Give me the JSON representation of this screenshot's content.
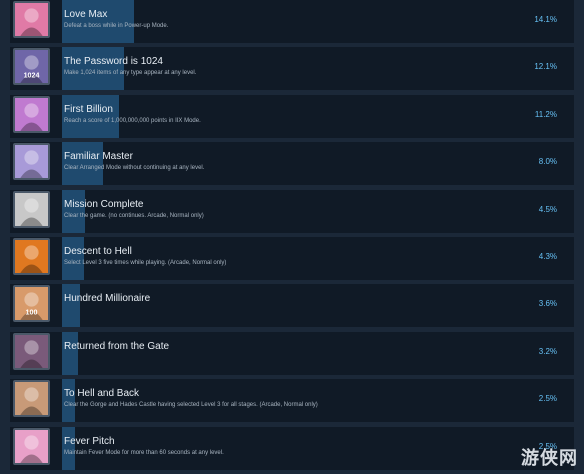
{
  "achievements": [
    {
      "title": "Love Max",
      "description": "Defeat a boss while in Power-up Mode.",
      "percent": "14.1%",
      "bar_fraction": 0.141,
      "icon": "love-max-icon",
      "icon_color": "#e07aa6"
    },
    {
      "title": "The Password is 1024",
      "description": "Make 1,024 items of any type appear at any level.",
      "percent": "12.1%",
      "bar_fraction": 0.121,
      "icon": "password-icon",
      "icon_color": "#6f66a8",
      "icon_text": "1024"
    },
    {
      "title": "First Billion",
      "description": "Reach a score of 1,000,000,000 points in IIX Mode.",
      "percent": "11.2%",
      "bar_fraction": 0.112,
      "icon": "first-billion-icon",
      "icon_color": "#c07ad0"
    },
    {
      "title": "Familiar Master",
      "description": "Clear Arranged Mode without continuing at any level.",
      "percent": "8.0%",
      "bar_fraction": 0.08,
      "icon": "familiar-master-icon",
      "icon_color": "#a89ad8"
    },
    {
      "title": "Mission Complete",
      "description": "Clear the game. (no continues. Arcade, Normal only)",
      "percent": "4.5%",
      "bar_fraction": 0.045,
      "icon": "mission-complete-icon",
      "icon_color": "#c8c8c8"
    },
    {
      "title": "Descent to Hell",
      "description": "Select Level 3 five times while playing. (Arcade, Normal only)",
      "percent": "4.3%",
      "bar_fraction": 0.043,
      "icon": "descent-to-hell-icon",
      "icon_color": "#e07820"
    },
    {
      "title": "Hundred Millionaire",
      "description": "",
      "percent": "3.6%",
      "bar_fraction": 0.036,
      "icon": "hundred-millionaire-icon",
      "icon_color": "#d89a6a",
      "icon_text": "100"
    },
    {
      "title": "Returned from the Gate",
      "description": "",
      "percent": "3.2%",
      "bar_fraction": 0.032,
      "icon": "returned-from-gate-icon",
      "icon_color": "#7a5a7a"
    },
    {
      "title": "To Hell and Back",
      "description": "Clear the Gorge and Hades Castle having selected Level 3 for all stages. (Arcade, Normal only)",
      "percent": "2.5%",
      "bar_fraction": 0.025,
      "icon": "to-hell-and-back-icon",
      "icon_color": "#c89a78"
    },
    {
      "title": "Fever Pitch",
      "description": "Maintain Fever Mode for more than 60 seconds at any level.",
      "percent": "2.5%",
      "bar_fraction": 0.025,
      "icon": "fever-pitch-icon",
      "icon_color": "#e8a0c8"
    }
  ],
  "watermark": "游侠网"
}
